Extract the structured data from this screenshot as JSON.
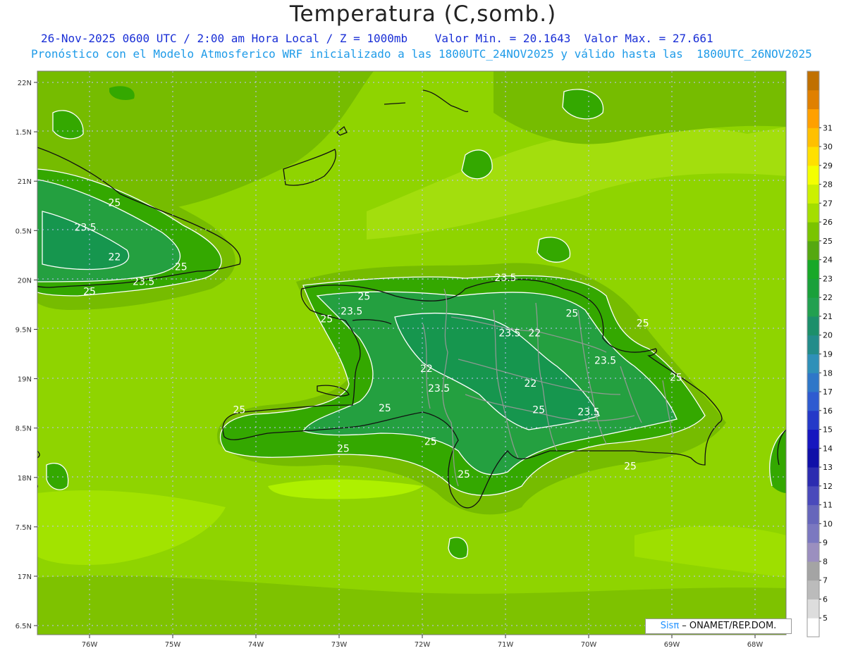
{
  "header": {
    "title": "Temperatura (C,somb.)",
    "line1": "26-Nov-2025 0600 UTC / 2:00 am Hora Local / Z = 1000mb    Valor Min. = 20.1643  Valor Max. = 27.661",
    "line2": "Pronóstico con el Modelo Atmosferico WRF inicializado a las 1800UTC_24NOV2025 y válido hasta las  1800UTC_26NOV2025"
  },
  "map": {
    "lon_labels": [
      "76W",
      "75W",
      "74W",
      "73W",
      "72W",
      "71W",
      "70W",
      "69W",
      "68W"
    ],
    "lat_labels": [
      "22N",
      "1.5N",
      "21N",
      "0.5N",
      "20N",
      "9.5N",
      "19N",
      "8.5N",
      "18N",
      "7.5N",
      "17N",
      "6.5N"
    ],
    "contour_labels": [
      {
        "text": "25",
        "lon": -75.7,
        "lat": 20.75
      },
      {
        "text": "23.5",
        "lon": -76.05,
        "lat": 20.5
      },
      {
        "text": "22",
        "lon": -75.7,
        "lat": 20.2
      },
      {
        "text": "25",
        "lon": -74.9,
        "lat": 20.1
      },
      {
        "text": "23.5",
        "lon": -75.35,
        "lat": 19.95
      },
      {
        "text": "25",
        "lon": -76.0,
        "lat": 19.85
      },
      {
        "text": "25",
        "lon": -72.7,
        "lat": 19.8
      },
      {
        "text": "23.5",
        "lon": -72.85,
        "lat": 19.65
      },
      {
        "text": "25",
        "lon": -73.15,
        "lat": 19.57
      },
      {
        "text": "23.5",
        "lon": -71.0,
        "lat": 19.99
      },
      {
        "text": "25",
        "lon": -70.2,
        "lat": 19.63
      },
      {
        "text": "25",
        "lon": -69.35,
        "lat": 19.53
      },
      {
        "text": "23.5",
        "lon": -70.95,
        "lat": 19.43
      },
      {
        "text": "22",
        "lon": -70.65,
        "lat": 19.43
      },
      {
        "text": "23.5",
        "lon": -69.8,
        "lat": 19.15
      },
      {
        "text": "22",
        "lon": -71.95,
        "lat": 19.07
      },
      {
        "text": "25",
        "lon": -68.95,
        "lat": 18.98
      },
      {
        "text": "22",
        "lon": -70.7,
        "lat": 18.92
      },
      {
        "text": "23.5",
        "lon": -71.8,
        "lat": 18.87
      },
      {
        "text": "25",
        "lon": -74.2,
        "lat": 18.65
      },
      {
        "text": "25",
        "lon": -72.45,
        "lat": 18.67
      },
      {
        "text": "25",
        "lon": -70.6,
        "lat": 18.65
      },
      {
        "text": "23.5",
        "lon": -70.0,
        "lat": 18.63
      },
      {
        "text": "25",
        "lon": -71.9,
        "lat": 18.33
      },
      {
        "text": "25",
        "lon": -72.95,
        "lat": 18.26
      },
      {
        "text": "25",
        "lon": -69.5,
        "lat": 18.08
      },
      {
        "text": "25",
        "lon": -71.5,
        "lat": 18.0
      }
    ]
  },
  "colorbar": {
    "levels": [
      "5",
      "6",
      "7",
      "8",
      "9",
      "10",
      "11",
      "12",
      "13",
      "14",
      "15",
      "16",
      "17",
      "18",
      "19",
      "20",
      "21",
      "22",
      "23",
      "24",
      "25",
      "26",
      "27",
      "28",
      "29",
      "30",
      "31"
    ],
    "colors": [
      "#ffffff",
      "#dddddd",
      "#bbbbbb",
      "#a4a4a4",
      "#9b8fbf",
      "#7b78c0",
      "#6666bb",
      "#4a4abb",
      "#2c2cb0",
      "#1010a8",
      "#1616bf",
      "#2439c8",
      "#2f5bd0",
      "#2f77c8",
      "#2f90b8",
      "#238c8a",
      "#1c8f6a",
      "#22a050",
      "#1aa03a",
      "#18a828",
      "#55a810",
      "#7ac400",
      "#a4de00",
      "#ccf000",
      "#f4ff00",
      "#ffe000",
      "#ffc000",
      "#ffa000",
      "#e08000",
      "#c07000"
    ]
  },
  "credit": {
    "sis": "Sisπ",
    "org": " – ONAMET/REP.DOM."
  }
}
